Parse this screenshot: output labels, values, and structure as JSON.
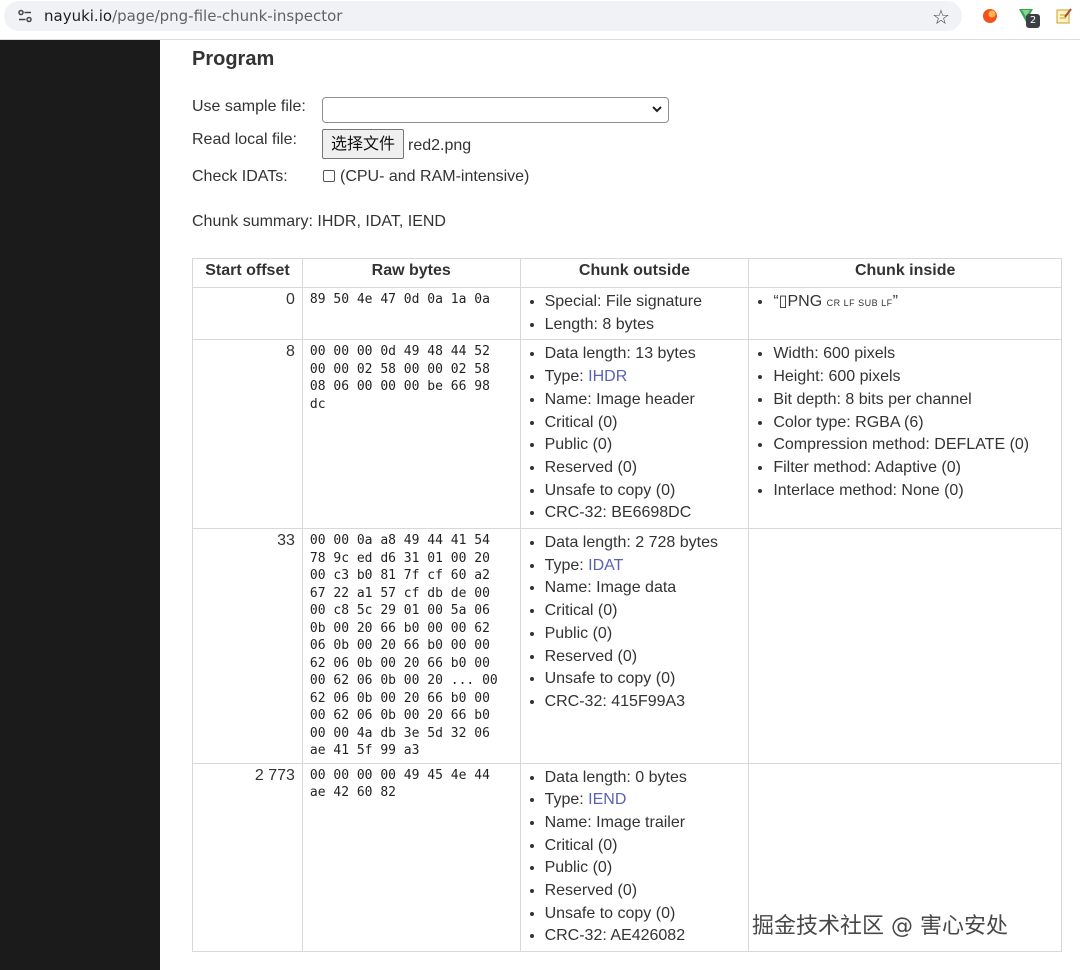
{
  "browser": {
    "url_host": "nayuki.io",
    "url_path": "/page/png-file-chunk-inspector",
    "extension_badge": "2"
  },
  "program": {
    "title": "Program",
    "sample_label": "Use sample file:",
    "sample_value": "",
    "local_label": "Read local file:",
    "file_button": "选择文件",
    "file_name": "red2.png",
    "check_label": "Check IDATs:",
    "check_text": "(CPU- and RAM-intensive)",
    "summary": "Chunk summary: IHDR, IDAT, IEND"
  },
  "table": {
    "headers": [
      "Start offset",
      "Raw bytes",
      "Chunk outside",
      "Chunk inside"
    ],
    "rows": [
      {
        "offset": "0",
        "raw": "89 50 4e 47 0d 0a 1a 0a",
        "outside": [
          "Special: File signature",
          "Length: 8 bytes"
        ],
        "inside_sig": {
          "open": "“",
          "box": "▯",
          "png": "PNG",
          "ctrl": "CR LF SUB LF",
          "close": "”"
        }
      },
      {
        "offset": "8",
        "raw": "00 00 00 0d 49 48 44 52 00 00 02 58 00 00 02 58 08 06 00 00 00 be 66 98 dc",
        "outside": {
          "data_length": "Data length: 13 bytes",
          "type_label": "Type: ",
          "type_value": "IHDR",
          "name": "Name: Image header",
          "critical": "Critical (0)",
          "public": "Public (0)",
          "reserved": "Reserved (0)",
          "unsafe": "Unsafe to copy (0)",
          "crc": "CRC-32: BE6698DC"
        },
        "inside": [
          "Width: 600 pixels",
          "Height: 600 pixels",
          "Bit depth: 8 bits per channel",
          "Color type: RGBA (6)",
          "Compression method: DEFLATE (0)",
          "Filter method: Adaptive (0)",
          "Interlace method: None (0)"
        ]
      },
      {
        "offset": "33",
        "raw": "00 00 0a a8 49 44 41 54 78 9c ed d6 31 01 00 20 00 c3 b0 81 7f cf 60 a2 67 22 a1 57 cf db de 00 00 c8 5c 29 01 00 5a 06 0b 00 20 66 b0 00 00 62 06 0b 00 20 66 b0 00 00 62 06 0b 00 20 66 b0 00 00 62 06 0b 00 20 ... 00 62 06 0b 00 20 66 b0 00 00 62 06 0b 00 20 66 b0 00 00 4a db 3e 5d 32 06 ae 41 5f 99 a3",
        "outside": {
          "data_length": "Data length: 2 728 bytes",
          "type_label": "Type: ",
          "type_value": "IDAT",
          "name": "Name: Image data",
          "critical": "Critical (0)",
          "public": "Public (0)",
          "reserved": "Reserved (0)",
          "unsafe": "Unsafe to copy (0)",
          "crc": "CRC-32: 415F99A3"
        }
      },
      {
        "offset": "2 773",
        "raw": "00 00 00 00 49 45 4e 44 ae 42 60 82",
        "outside": {
          "data_length": "Data length: 0 bytes",
          "type_label": "Type: ",
          "type_value": "IEND",
          "name": "Name: Image trailer",
          "critical": "Critical (0)",
          "public": "Public (0)",
          "reserved": "Reserved (0)",
          "unsafe": "Unsafe to copy (0)",
          "crc": "CRC-32: AE426082"
        }
      }
    ]
  },
  "watermark": "掘金技术社区 @ 害心安处",
  "colors": {
    "link": "#5a62b5",
    "dark_panel": "#1b1b1b"
  }
}
